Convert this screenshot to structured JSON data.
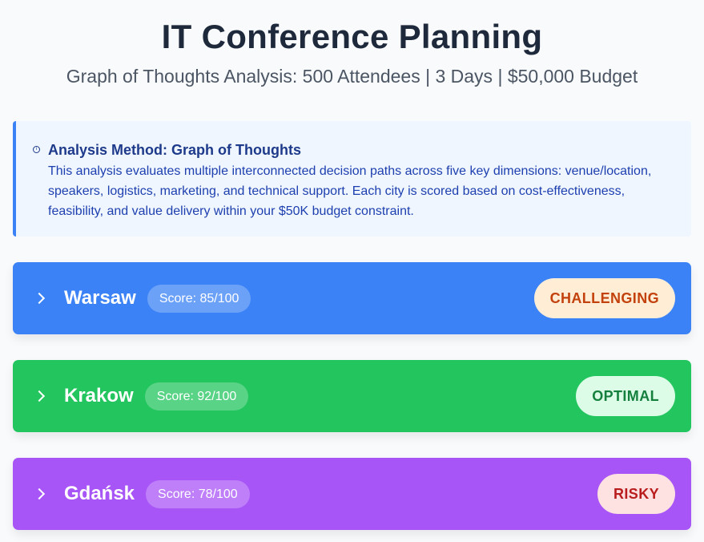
{
  "header": {
    "title": "IT Conference Planning",
    "subtitle": "Graph of Thoughts Analysis: 500 Attendees | 3 Days | $50,000 Budget"
  },
  "method": {
    "icon": "info-icon",
    "title": "Analysis Method: Graph of Thoughts",
    "text": "This analysis evaluates multiple interconnected decision paths across five key dimensions: venue/location, speakers, logistics, marketing, and technical support. Each city is scored based on cost-effectiveness, feasibility, and value delivery within your $50K budget constraint."
  },
  "cities": [
    {
      "name": "Warsaw",
      "score": "Score: 85/100",
      "status": "CHALLENGING",
      "color": "#3b82f6",
      "status_bg": "#ffedd5",
      "status_color": "#c2410c"
    },
    {
      "name": "Krakow",
      "score": "Score: 92/100",
      "status": "OPTIMAL",
      "color": "#22c55e",
      "status_bg": "#dcfce7",
      "status_color": "#15803d"
    },
    {
      "name": "Gdańsk",
      "score": "Score: 78/100",
      "status": "RISKY",
      "color": "#a855f7",
      "status_bg": "#fee2e2",
      "status_color": "#b91c1c"
    }
  ]
}
